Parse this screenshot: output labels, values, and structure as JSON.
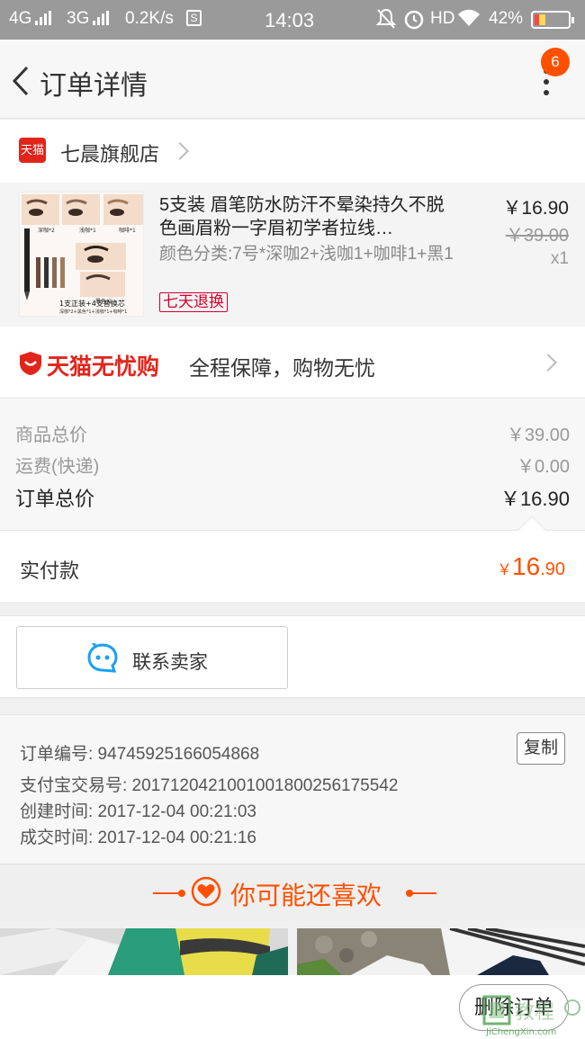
{
  "status_bar": {
    "network1": "4G",
    "network2": "3G",
    "speed": "0.2K/s",
    "time": "14:03",
    "hd": "HD",
    "battery": "42%",
    "battery_level": 0.42
  },
  "nav": {
    "title": "订单详情",
    "badge_count": "6"
  },
  "shop": {
    "logo_text": "天猫",
    "name": "七晨旗舰店"
  },
  "product": {
    "title": "5支装 眉笔防水防汗不晕染持久不脱色画眉粉一字眉初学者拉线…",
    "sku": "颜色分类:7号*深咖2+浅咖1+咖啡1+黑1",
    "refund_tag": "七天退换",
    "price": "￥16.90",
    "original_price": "￥39.00",
    "quantity": "x1",
    "thumb_caption": "1支正装+4支替换芯",
    "thumb_sub": "深咖*2+黑色*1+浅咖*1+咖啡*1",
    "thumb_labels": [
      "深咖*2",
      "浅咖*1",
      "咖啡*1",
      "黑色*1"
    ]
  },
  "guarantee": {
    "brand": "天猫无忧购",
    "text": "全程保障，购物无忧"
  },
  "summary": {
    "goods_total_label": "商品总价",
    "goods_total_value": "￥39.00",
    "shipping_label": "运费(快递)",
    "shipping_value": "￥0.00",
    "order_total_label": "订单总价",
    "order_total_value": "￥16.90"
  },
  "payment": {
    "label": "实付款",
    "currency": "￥",
    "integer": "16",
    "decimal": ".90"
  },
  "contact": {
    "label": "联系卖家"
  },
  "order_info": {
    "order_no": "订单编号: 94745925166054868",
    "alipay_no": "支付宝交易号: 2017120421001001800256175542",
    "created": "创建时间: 2017-12-04 00:21:03",
    "completed": "成交时间: 2017-12-04 00:21:16",
    "copy_label": "复制"
  },
  "recommend": {
    "title": "你可能还喜欢"
  },
  "footer": {
    "delete_label": "删除订单",
    "watermark": "JiChengXin.com"
  },
  "colors": {
    "accent": "#ff5000",
    "tmall_red": "#e1251b",
    "chat_blue": "#1aa0f0"
  }
}
